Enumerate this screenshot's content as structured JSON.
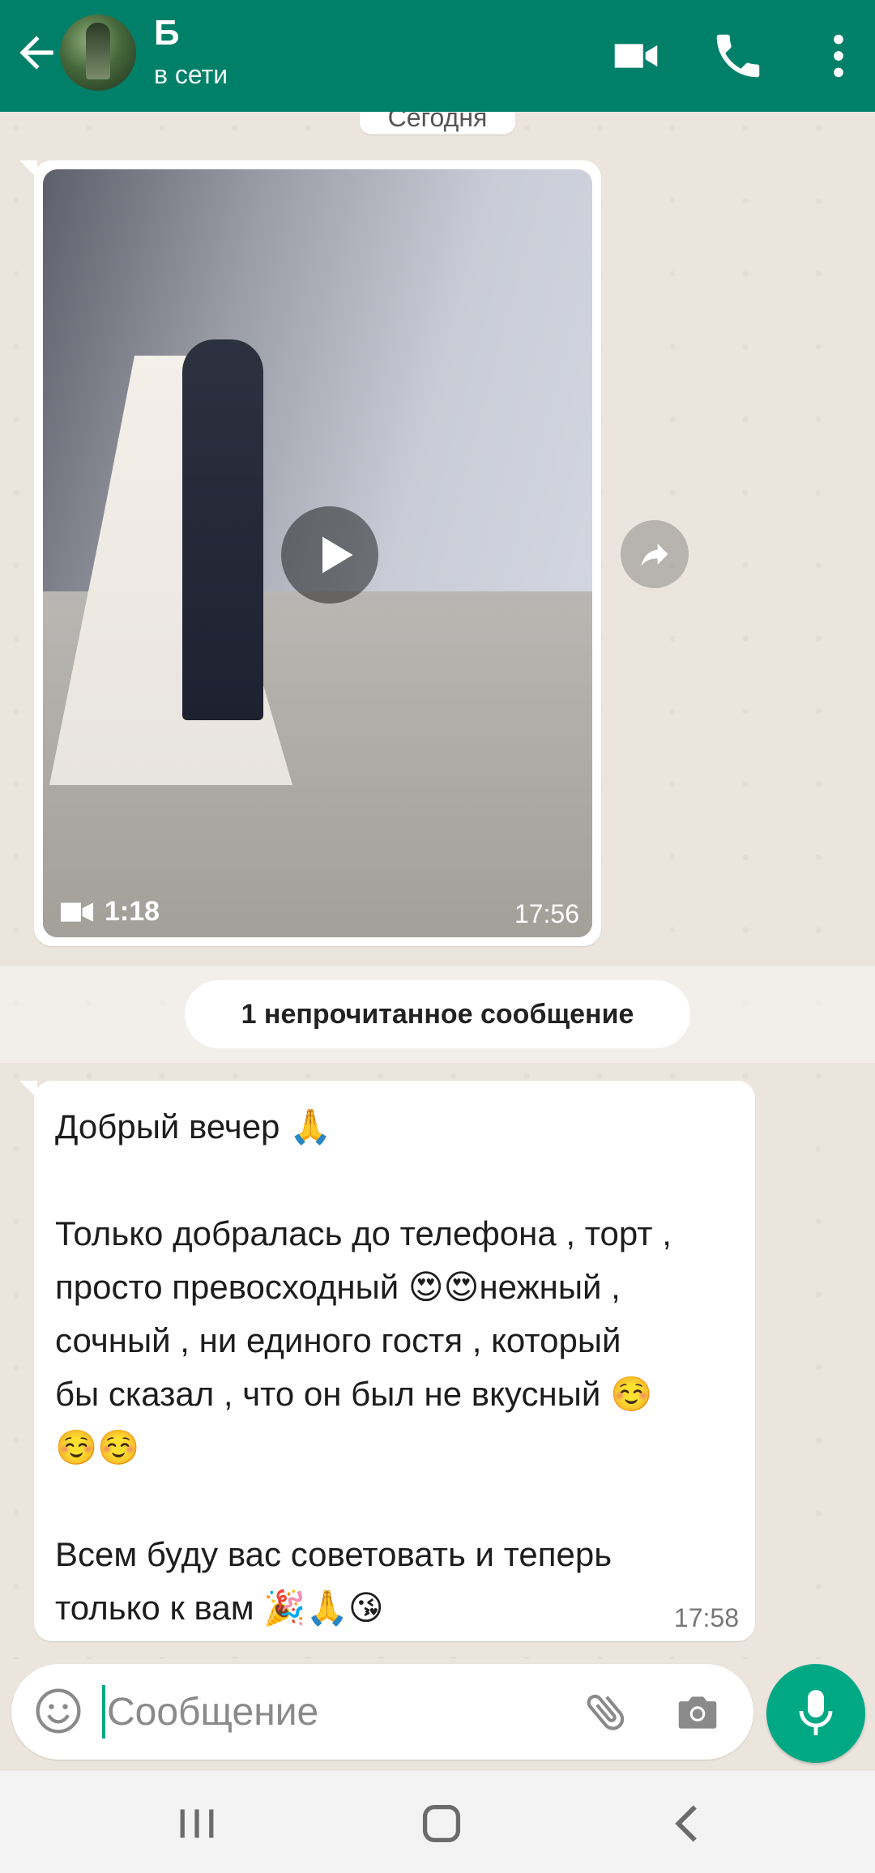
{
  "header": {
    "contact_name": "Б",
    "status": "в сети",
    "icons": [
      "back-arrow-icon",
      "video-call-icon",
      "phone-icon",
      "more-vert-icon"
    ]
  },
  "chat": {
    "date_chip": "Сегодня",
    "video_message": {
      "duration": "1:18",
      "time": "17:56"
    },
    "unread_banner": "1 непрочитанное сообщение",
    "text_message": {
      "text": "Добрый вечер 🙏\n\nТолько добралась до телефона , торт ,\nпросто превосходный 😍😍нежный ,\nсочный , ни единого гостя , который\nбы сказал , что он был не вкусный ☺️\n☺️☺️\n\nВсем буду вас советовать и теперь\nтолько к вам 🎉🙏😘",
      "time": "17:58"
    }
  },
  "composer": {
    "placeholder": "Сообщение",
    "value": ""
  },
  "colors": {
    "header": "#008069",
    "accent": "#00a884",
    "chat_bg": "#ece5dd"
  }
}
